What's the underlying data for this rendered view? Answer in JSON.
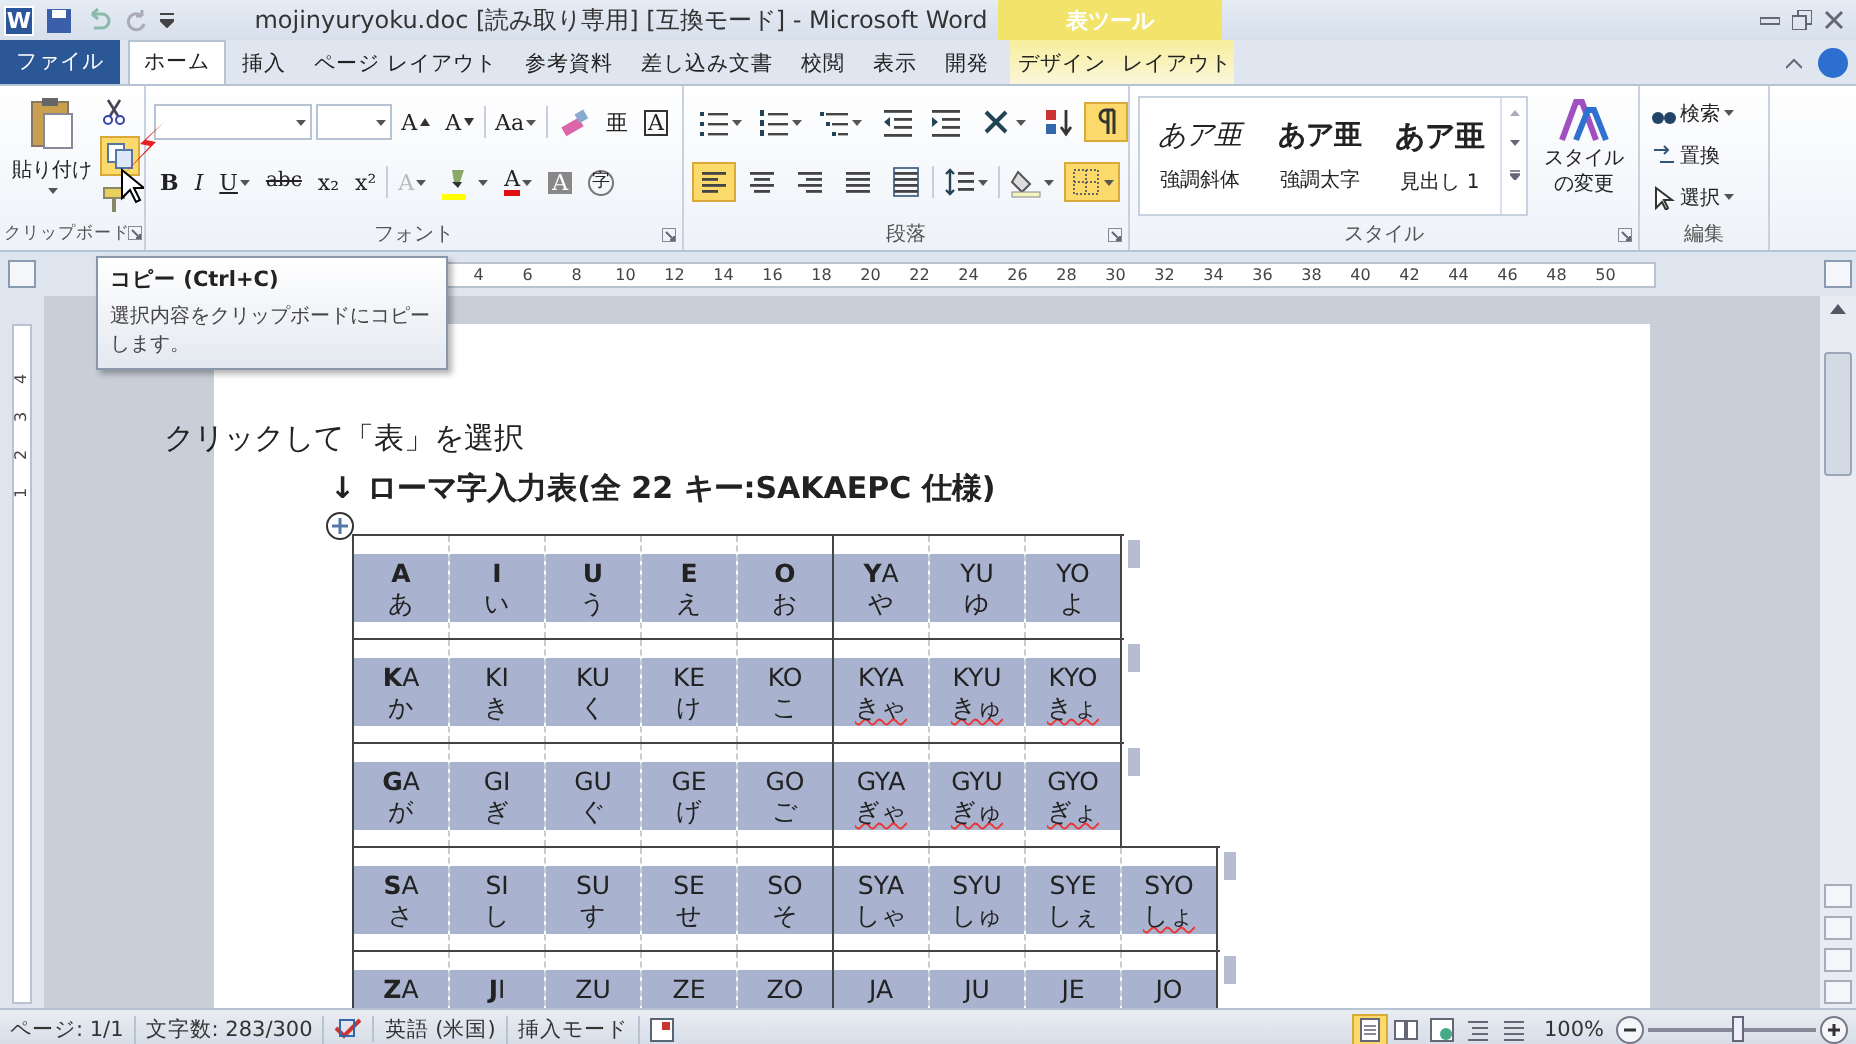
{
  "title_bar": {
    "app_icon": "W",
    "title": "mojinyuryoku.doc [読み取り専用] [互換モード] - Microsoft Word",
    "context_label": "表ツール"
  },
  "tabs": [
    {
      "label": "ファイル",
      "kind": "file",
      "selected": false
    },
    {
      "label": "ホーム",
      "kind": "normal",
      "selected": true
    },
    {
      "label": "挿入",
      "kind": "normal",
      "selected": false
    },
    {
      "label": "ページ レイアウト",
      "kind": "normal",
      "selected": false
    },
    {
      "label": "参考資料",
      "kind": "normal",
      "selected": false
    },
    {
      "label": "差し込み文書",
      "kind": "normal",
      "selected": false
    },
    {
      "label": "校閲",
      "kind": "normal",
      "selected": false
    },
    {
      "label": "表示",
      "kind": "normal",
      "selected": false
    },
    {
      "label": "開発",
      "kind": "normal",
      "selected": false
    },
    {
      "label": "デザイン",
      "kind": "context",
      "selected": false
    },
    {
      "label": "レイアウト",
      "kind": "context",
      "selected": false
    }
  ],
  "ribbon": {
    "clipboard": {
      "paste_label": "貼り付け",
      "label": "クリップボード",
      "copy_hovered": true
    },
    "font": {
      "label": "フォント",
      "row1": [
        {
          "kind": "grow",
          "text": "A"
        },
        {
          "kind": "shrink",
          "text": "A"
        },
        {
          "kind": "sep"
        },
        {
          "kind": "glyph",
          "text": "Aa",
          "dropdown": true
        },
        {
          "kind": "sep"
        },
        {
          "kind": "clear"
        },
        {
          "kind": "glyph",
          "text": "亜"
        },
        {
          "kind": "boxed",
          "text": "A"
        }
      ],
      "row2": [
        {
          "kind": "bold",
          "text": "B"
        },
        {
          "kind": "italic",
          "text": "I"
        },
        {
          "kind": "underline",
          "text": "U",
          "dropdown": true
        },
        {
          "kind": "strike",
          "text": "abc"
        },
        {
          "kind": "glyph",
          "text": "x₂"
        },
        {
          "kind": "glyph",
          "text": "x²"
        },
        {
          "kind": "sep"
        },
        {
          "kind": "outline",
          "text": "A",
          "dropdown": true
        },
        {
          "kind": "highlighter",
          "color": "#ffff00",
          "dropdown": true
        },
        {
          "kind": "colored",
          "text": "A",
          "color": "#e01010",
          "dropdown": true
        },
        {
          "kind": "shaded",
          "text": "A"
        },
        {
          "kind": "circled",
          "text": "字"
        }
      ]
    },
    "paragraph": {
      "label": "段落",
      "row1": [
        {
          "kind": "bullets",
          "dropdown": true,
          "selected": false
        },
        {
          "kind": "numbering",
          "dropdown": true,
          "selected": false
        },
        {
          "kind": "multilevel",
          "dropdown": true,
          "selected": false
        },
        {
          "kind": "sep"
        },
        {
          "kind": "outdent",
          "selected": false
        },
        {
          "kind": "indent",
          "selected": false
        },
        {
          "kind": "sep"
        },
        {
          "kind": "asian",
          "dropdown": true,
          "selected": false
        },
        {
          "kind": "sort",
          "selected": false
        },
        {
          "kind": "marks",
          "selected": true
        }
      ],
      "row2": [
        {
          "kind": "align-left",
          "selected": true
        },
        {
          "kind": "align-center",
          "selected": false
        },
        {
          "kind": "align-right",
          "selected": false
        },
        {
          "kind": "justify",
          "selected": false
        },
        {
          "kind": "distribute",
          "selected": false
        },
        {
          "kind": "sep"
        },
        {
          "kind": "line-spacing",
          "dropdown": true,
          "selected": false
        },
        {
          "kind": "sep"
        },
        {
          "kind": "shading",
          "dropdown": true,
          "selected": false
        },
        {
          "kind": "borders",
          "dropdown": true,
          "selected": true
        }
      ]
    },
    "styles": {
      "label": "スタイル",
      "items": [
        {
          "preview": "あア亜",
          "caption": "強調斜体",
          "kind": "italic"
        },
        {
          "preview": "あア亜",
          "caption": "強調太字",
          "kind": "bold"
        },
        {
          "preview": "あア亜",
          "caption": "見出し 1",
          "kind": "heading"
        }
      ],
      "change_label": "スタイルの変更"
    },
    "editing": {
      "label": "編集",
      "items": [
        {
          "label": "検索",
          "kind": "find",
          "dropdown": true
        },
        {
          "label": "置換",
          "kind": "replace",
          "dropdown": false
        },
        {
          "label": "選択",
          "kind": "select",
          "dropdown": true
        }
      ]
    }
  },
  "tooltip": {
    "title": "コピー (Ctrl+C)",
    "text": "選択内容をクリップボードにコピーします。"
  },
  "ruler": {
    "numbers": [
      "4",
      "6",
      "8",
      "10",
      "12",
      "14",
      "16",
      "18",
      "20",
      "22",
      "24",
      "26",
      "28",
      "30",
      "32",
      "34",
      "36",
      "38",
      "40",
      "42",
      "44",
      "46",
      "48",
      "50"
    ],
    "vertical_numbers": [
      "4",
      "3",
      "2",
      "1"
    ]
  },
  "document": {
    "annotation": "クリックして「表」を選択",
    "arrow": "↓",
    "heading": "ローマ字入力表(全 22 キー:SAKAEPC 仕様)",
    "rows": [
      {
        "cells": [
          {
            "romaji": "A",
            "bold": true,
            "kana": "あ",
            "underlined": false
          },
          {
            "romaji": "I",
            "bold": true,
            "kana": "い",
            "underlined": false
          },
          {
            "romaji": "U",
            "bold": true,
            "kana": "う",
            "underlined": false
          },
          {
            "romaji": "E",
            "bold": true,
            "kana": "え",
            "underlined": false
          },
          {
            "romaji": "O",
            "bold": true,
            "kana": "お",
            "underlined": false
          },
          {
            "romaji": "**Y**A",
            "bold": false,
            "kana": "や",
            "underlined": false
          },
          {
            "romaji": "YU",
            "bold": false,
            "kana": "ゆ",
            "underlined": false
          },
          {
            "romaji": "YO",
            "bold": false,
            "kana": "よ",
            "underlined": false
          }
        ]
      },
      {
        "cells": [
          {
            "romaji": "**K**A",
            "bold": false,
            "kana": "か",
            "underlined": false
          },
          {
            "romaji": "KI",
            "bold": false,
            "kana": "き",
            "underlined": false
          },
          {
            "romaji": "KU",
            "bold": false,
            "kana": "く",
            "underlined": false
          },
          {
            "romaji": "KE",
            "bold": false,
            "kana": "け",
            "underlined": false
          },
          {
            "romaji": "KO",
            "bold": false,
            "kana": "こ",
            "underlined": false
          },
          {
            "romaji": "KYA",
            "bold": false,
            "kana": "きゃ",
            "underlined": true
          },
          {
            "romaji": "KYU",
            "bold": false,
            "kana": "きゅ",
            "underlined": true
          },
          {
            "romaji": "KYO",
            "bold": false,
            "kana": "きょ",
            "underlined": true
          }
        ]
      },
      {
        "cells": [
          {
            "romaji": "**G**A",
            "bold": false,
            "kana": "が",
            "underlined": false
          },
          {
            "romaji": "GI",
            "bold": false,
            "kana": "ぎ",
            "underlined": false
          },
          {
            "romaji": "GU",
            "bold": false,
            "kana": "ぐ",
            "underlined": false
          },
          {
            "romaji": "GE",
            "bold": false,
            "kana": "げ",
            "underlined": false
          },
          {
            "romaji": "GO",
            "bold": false,
            "kana": "ご",
            "underlined": false
          },
          {
            "romaji": "GYA",
            "bold": false,
            "kana": "ぎゃ",
            "underlined": true
          },
          {
            "romaji": "GYU",
            "bold": false,
            "kana": "ぎゅ",
            "underlined": true
          },
          {
            "romaji": "GYO",
            "bold": false,
            "kana": "ぎょ",
            "underlined": true
          }
        ]
      },
      {
        "cells": [
          {
            "romaji": "**S**A",
            "bold": false,
            "kana": "さ",
            "underlined": false
          },
          {
            "romaji": "SI",
            "bold": false,
            "kana": "し",
            "underlined": false
          },
          {
            "romaji": "SU",
            "bold": false,
            "kana": "す",
            "underlined": false
          },
          {
            "romaji": "SE",
            "bold": false,
            "kana": "せ",
            "underlined": false
          },
          {
            "romaji": "SO",
            "bold": false,
            "kana": "そ",
            "underlined": false
          },
          {
            "romaji": "SYA",
            "bold": false,
            "kana": "しゃ",
            "underlined": false
          },
          {
            "romaji": "SYU",
            "bold": false,
            "kana": "しゅ",
            "underlined": false
          },
          {
            "romaji": "SYE",
            "bold": false,
            "kana": "しぇ",
            "underlined": false
          },
          {
            "romaji": "SYO",
            "bold": false,
            "kana": "しょ",
            "underlined": true
          }
        ]
      },
      {
        "cells": [
          {
            "romaji": "**Z**A",
            "bold": false
          },
          {
            "romaji": "**J**I",
            "bold": false
          },
          {
            "romaji": "ZU",
            "bold": false
          },
          {
            "romaji": "ZE",
            "bold": false
          },
          {
            "romaji": "ZO",
            "bold": false
          },
          {
            "romaji": "JA",
            "bold": false
          },
          {
            "romaji": "JU",
            "bold": false
          },
          {
            "romaji": "JE",
            "bold": false
          },
          {
            "romaji": "JO",
            "bold": false
          }
        ]
      }
    ]
  },
  "status_bar": {
    "page": "ページ: 1/1",
    "words": "文字数: 283/300",
    "language": "英語 (米国)",
    "mode": "挿入モード",
    "views": [
      {
        "kind": "print",
        "selected": true
      },
      {
        "kind": "reading",
        "selected": false
      },
      {
        "kind": "web",
        "selected": false
      },
      {
        "kind": "outline",
        "selected": false
      },
      {
        "kind": "draft",
        "selected": false
      }
    ],
    "zoom": "100%",
    "zoom_slider": {
      "level": 0.53
    }
  }
}
